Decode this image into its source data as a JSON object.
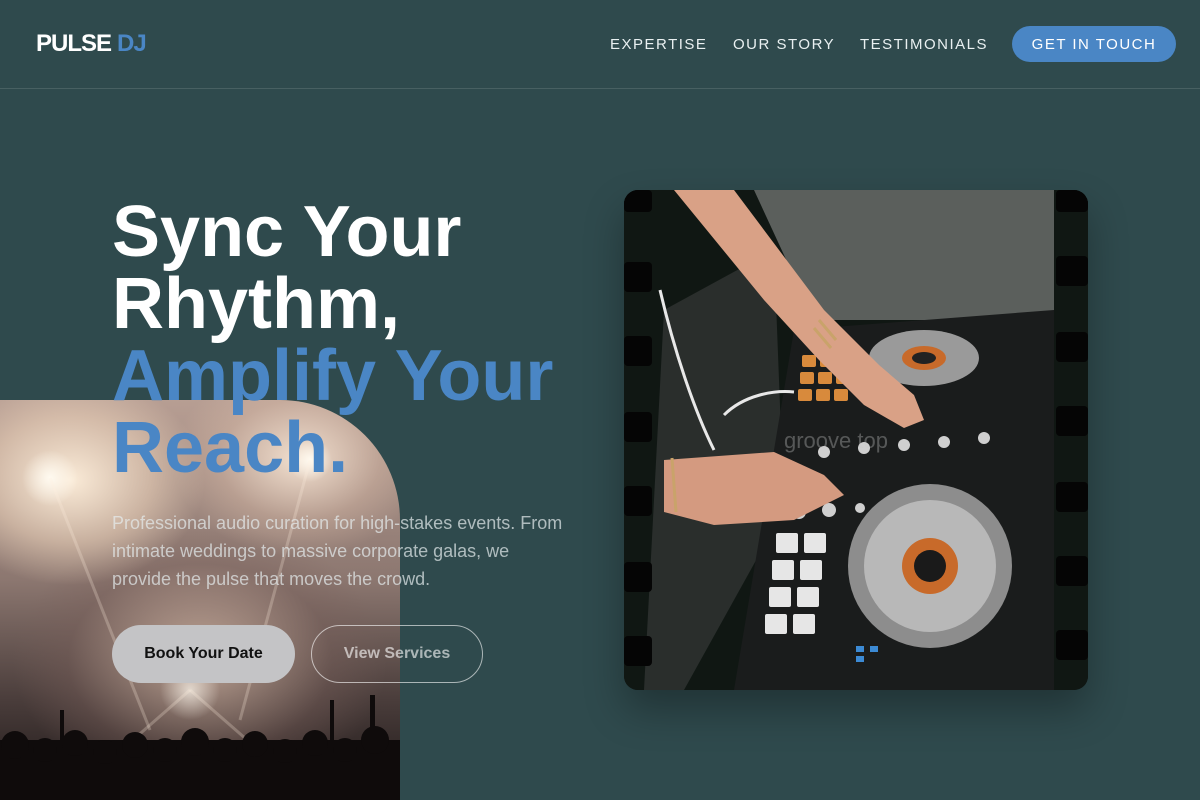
{
  "brand": {
    "name": "PULSE",
    "suffix": "DJ",
    "accent": "#4a86c5",
    "background": "#2f4a4d"
  },
  "nav": {
    "links": [
      "EXPERTISE",
      "OUR STORY",
      "TESTIMONIALS"
    ],
    "cta": "GET IN TOUCH"
  },
  "hero": {
    "headline_line1": "Sync Your",
    "headline_line2": "Rhythm,",
    "headline_line3": "Amplify Your",
    "headline_line4": "Reach.",
    "lead": "Professional audio curation for high-stakes events. From intimate weddings to massive corporate galas, we provide the pulse that moves the crowd.",
    "primary_button": "Book Your Date",
    "secondary_button": "View Services"
  },
  "images": {
    "concert": "concert-crowd-photo",
    "dj": "dj-controller-photo",
    "dj_watermark": "groove top"
  }
}
